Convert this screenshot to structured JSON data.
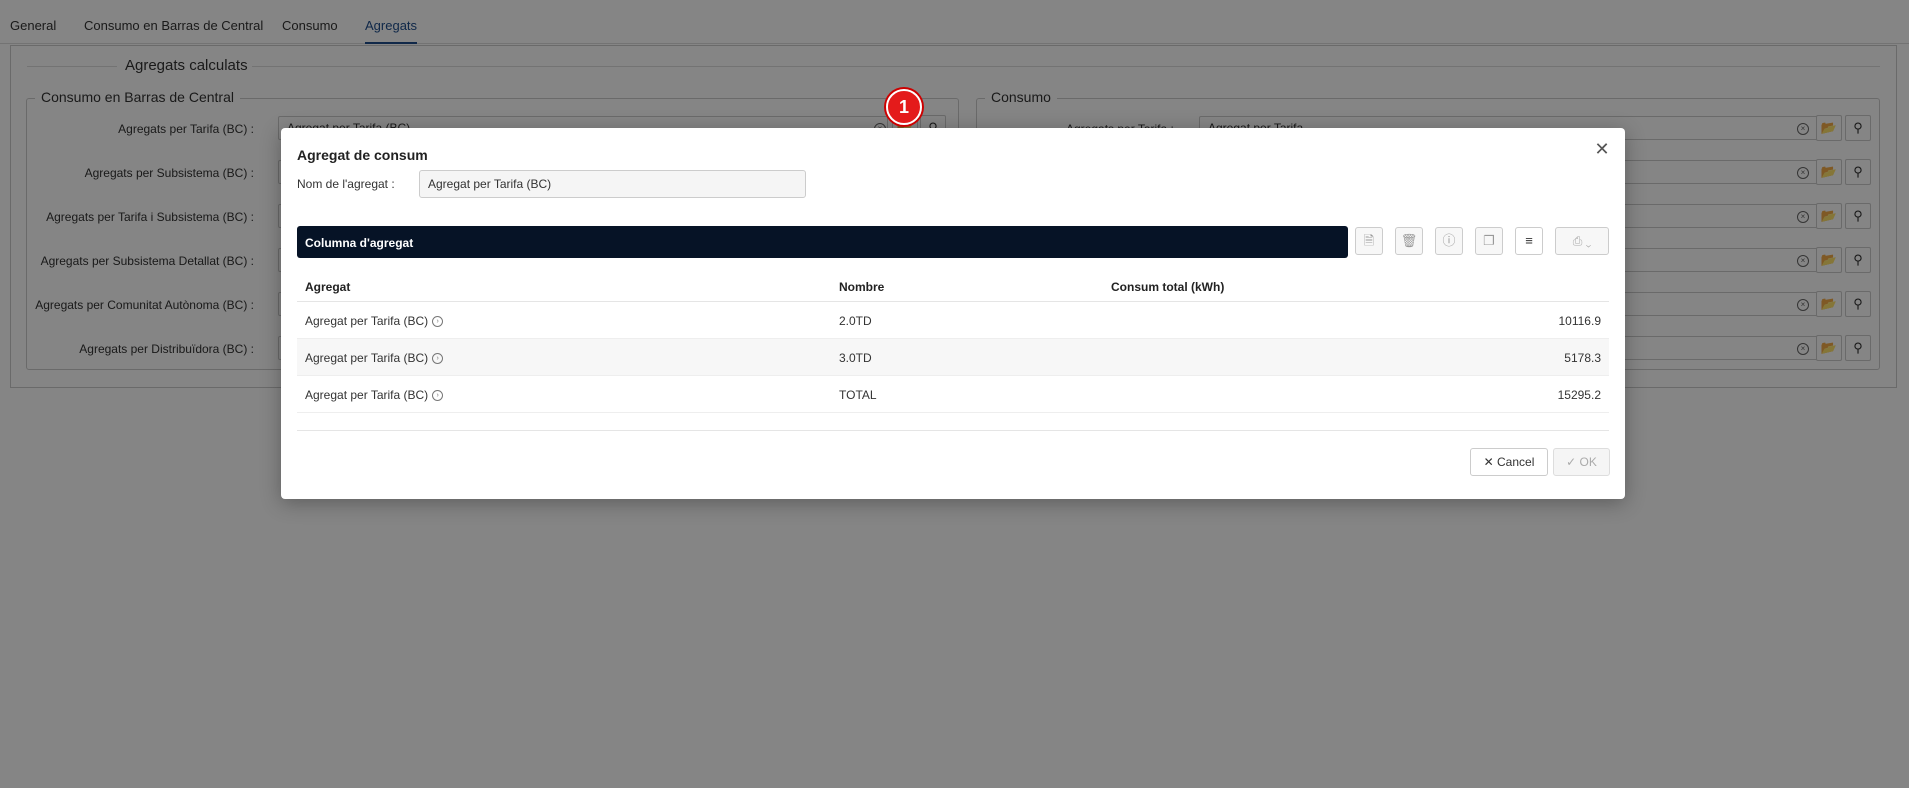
{
  "tabs": [
    "General",
    "Consumo en Barras de Central",
    "Consumo",
    "Agregats"
  ],
  "active_tab": "Agregats",
  "page": {
    "section_title": "Agregats calculats",
    "left_group": {
      "legend": "Consumo en Barras de Central",
      "rows": [
        {
          "label": "Agregats per Tarifa (BC) :",
          "value": "Agregat per Tarifa (BC)"
        },
        {
          "label": "Agregats per Subsistema (BC) :",
          "value": ""
        },
        {
          "label": "Agregats per Tarifa i Subsistema (BC) :",
          "value": ""
        },
        {
          "label": "Agregats per Subsistema Detallat (BC) :",
          "value": ""
        },
        {
          "label": "Agregats per Comunitat Autònoma (BC) :",
          "value": ""
        },
        {
          "label": "Agregats per Distribuïdora (BC) :",
          "value": ""
        }
      ]
    },
    "right_group": {
      "legend": "Consumo",
      "rows": [
        {
          "label": "Agregats per Tarifa :",
          "value": "Agregat per Tarifa"
        }
      ]
    }
  },
  "badge": "1",
  "modal": {
    "title": "Agregat de consum",
    "name_label": "Nom de l'agregat :",
    "name_value": "Agregat per Tarifa (BC)",
    "grid_title": "Columna d'agregat",
    "columns": [
      "Agregat",
      "Nombre",
      "Consum total (kWh)"
    ],
    "rows": [
      {
        "agregat": "Agregat per Tarifa (BC)",
        "nombre": "2.0TD",
        "consum": "10116.9"
      },
      {
        "agregat": "Agregat per Tarifa (BC)",
        "nombre": "3.0TD",
        "consum": "5178.3"
      },
      {
        "agregat": "Agregat per Tarifa (BC)",
        "nombre": "TOTAL",
        "consum": "15295.2"
      }
    ],
    "cancel_label": "Cancel",
    "ok_label": "OK"
  }
}
